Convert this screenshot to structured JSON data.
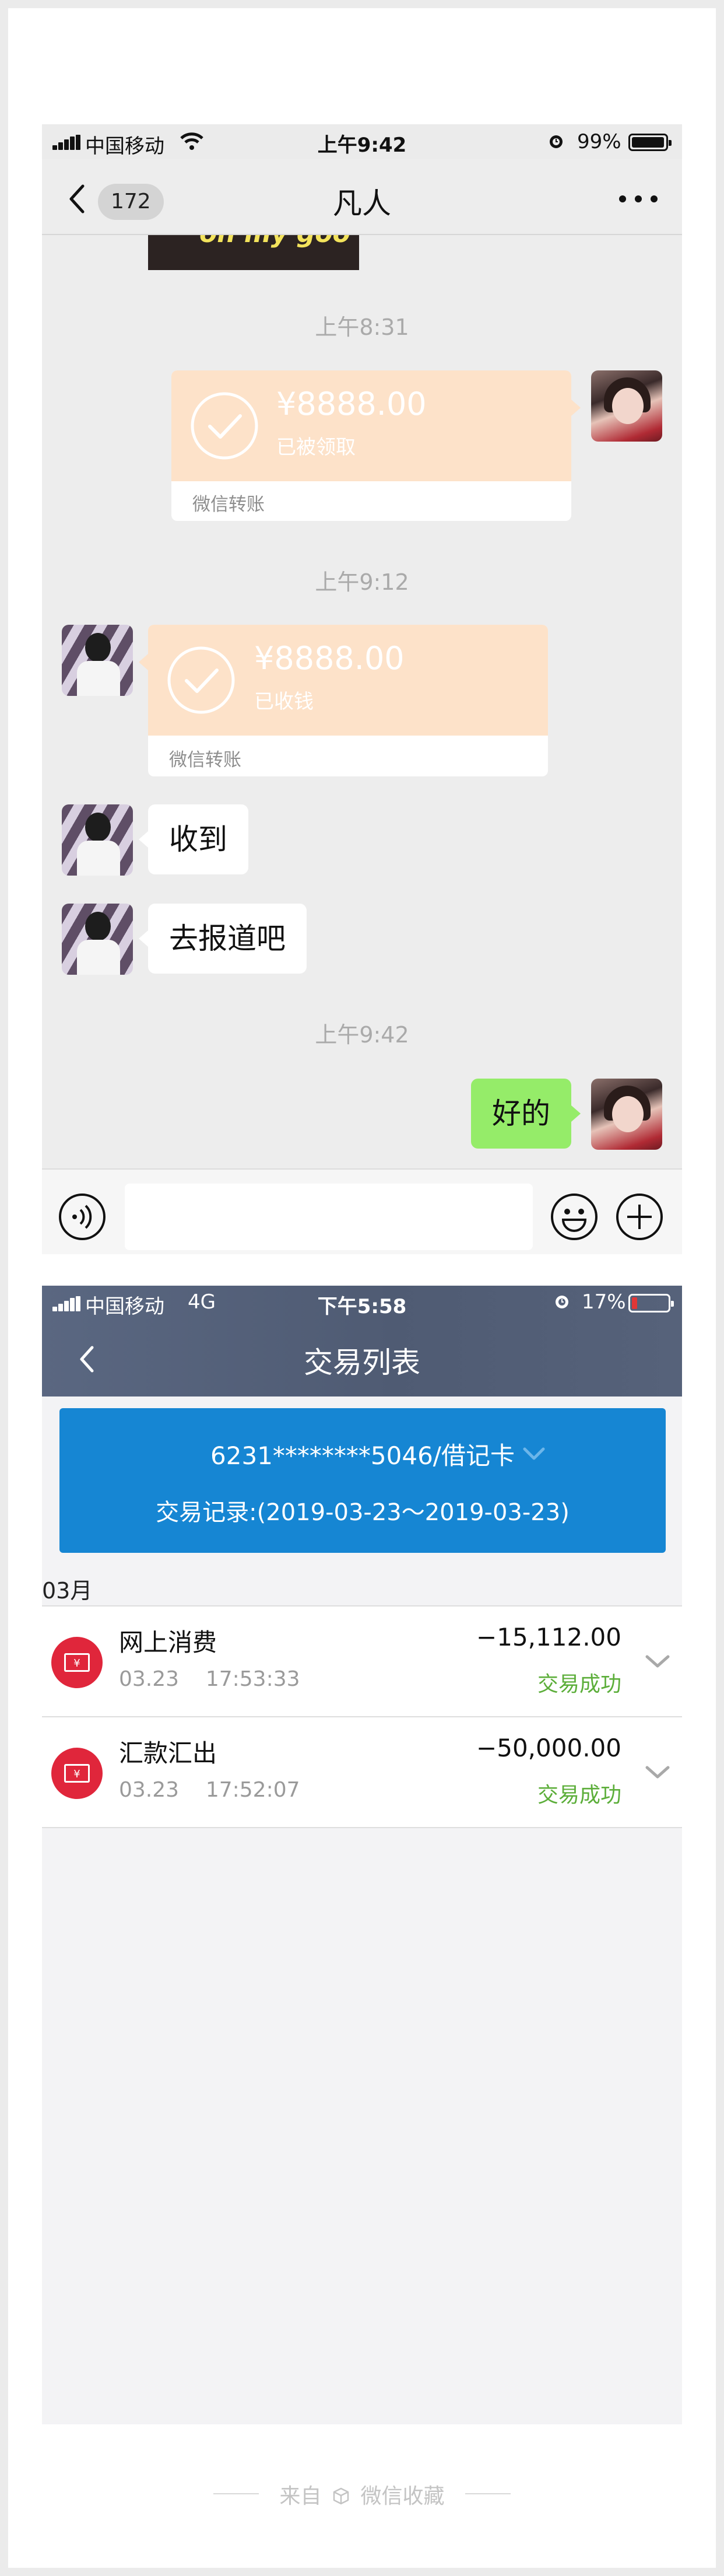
{
  "wechat": {
    "status": {
      "carrier": "中国移动",
      "time": "上午9:42",
      "battery": "99%"
    },
    "nav": {
      "unread_count": "172",
      "title": "凡人"
    },
    "video_caption": "on my goo",
    "messages": {
      "ts1": "上午8:31",
      "transfer_sent": {
        "amount": "¥8888.00",
        "status": "已被领取",
        "label": "微信转账"
      },
      "ts2": "上午9:12",
      "transfer_received": {
        "amount": "¥8888.00",
        "status": "已收钱",
        "label": "微信转账"
      },
      "msg_received_1": "收到",
      "msg_received_2": "去报道吧",
      "ts3": "上午9:42",
      "msg_sent": "好的"
    }
  },
  "bank": {
    "status": {
      "carrier": "中国移动",
      "network": "4G",
      "time": "下午5:58",
      "battery": "17%"
    },
    "title": "交易列表",
    "card": {
      "account": "6231********5046/借记卡",
      "range": "交易记录:(2019-03-23～2019-03-23)"
    },
    "month": "03月",
    "transactions": [
      {
        "name": "网上消费",
        "datetime": "03.23    17:53:33",
        "amount": "−15,112.00",
        "status": "交易成功"
      },
      {
        "name": "汇款汇出",
        "datetime": "03.23    17:52:07",
        "amount": "−50,000.00",
        "status": "交易成功"
      }
    ]
  },
  "footer": {
    "prefix": "来自",
    "source": "微信收藏"
  },
  "colors": {
    "wechat_green": "#95ec69",
    "transfer_orange": "#fde2c9",
    "bank_blue": "#1686d3",
    "success_green": "#5cae3a",
    "icon_red": "#e0263b"
  }
}
